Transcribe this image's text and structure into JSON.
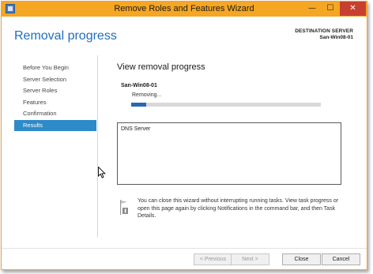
{
  "window": {
    "title": "Remove Roles and Features Wizard",
    "minimize_glyph": "—",
    "maximize_glyph": "☐",
    "close_glyph": "✕"
  },
  "header": {
    "title": "Removal progress",
    "destination_label": "DESTINATION SERVER",
    "destination_server": "San-Win08-01"
  },
  "nav": {
    "items": [
      {
        "label": "Before You Begin"
      },
      {
        "label": "Server Selection"
      },
      {
        "label": "Server Roles"
      },
      {
        "label": "Features"
      },
      {
        "label": "Confirmation"
      },
      {
        "label": "Results"
      }
    ],
    "active_index": 5
  },
  "main": {
    "title": "View removal progress",
    "server_name": "San-Win08-01",
    "status": "Removing...",
    "progress_fraction": 0.08,
    "results": [
      "DNS Server"
    ],
    "info_text": "You can close this wizard without interrupting running tasks. View task progress or open this page again by clicking Notifications in the command bar, and then Task Details."
  },
  "footer": {
    "previous_label": "< Previous",
    "next_label": "Next >",
    "close_label": "Close",
    "cancel_label": "Cancel"
  },
  "colors": {
    "titlebar": "#f5a623",
    "accent": "#1e6fbf",
    "nav_active": "#2e8bc9",
    "progress_fill": "#2a67b0",
    "close_button": "#c7402f"
  },
  "icons": [
    "app-icon",
    "minimize-icon",
    "maximize-icon",
    "close-icon",
    "flag-info-icon",
    "mouse-cursor-icon"
  ]
}
